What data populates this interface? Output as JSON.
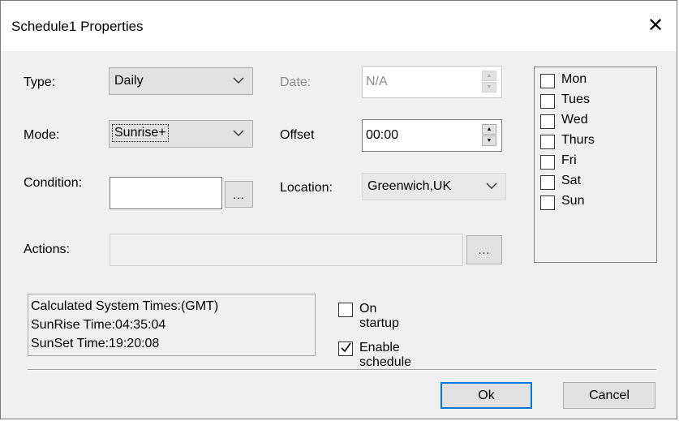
{
  "window": {
    "title": "Schedule1 Properties",
    "close_symbol": "✕"
  },
  "form": {
    "type_label": "Type:",
    "type_value": "Daily",
    "date_label": "Date:",
    "date_value": "N/A",
    "mode_label": "Mode:",
    "mode_value": "Sunrise+",
    "offset_label": "Offset",
    "offset_value": "00:00",
    "condition_label": "Condition:",
    "condition_value": "",
    "condition_browse": "...",
    "location_label": "Location:",
    "location_value": "Greenwich,UK",
    "actions_label": "Actions:",
    "actions_value": "",
    "actions_browse": "..."
  },
  "days": [
    {
      "label": "Mon",
      "checked": false
    },
    {
      "label": "Tues",
      "checked": false
    },
    {
      "label": "Wed",
      "checked": false
    },
    {
      "label": "Thurs",
      "checked": false
    },
    {
      "label": "Fri",
      "checked": false
    },
    {
      "label": "Sat",
      "checked": false
    },
    {
      "label": "Sun",
      "checked": false
    }
  ],
  "calculated": {
    "heading": "Calculated System Times:(GMT)",
    "sunrise": "SunRise Time:04:35:04",
    "sunset": "SunSet Time:19:20:08"
  },
  "options": {
    "on_startup_label": "On startup",
    "on_startup_checked": false,
    "enable_schedule_label": "Enable schedule",
    "enable_schedule_checked": true
  },
  "buttons": {
    "ok": "Ok",
    "cancel": "Cancel"
  },
  "colors": {
    "default_button_border": "#0078d7",
    "dialog_bg": "#f0f0f0"
  },
  "icons": {
    "dropdown": "chevron-down-icon",
    "spin_up": "spin-up-icon",
    "spin_down": "spin-down-icon",
    "checkmark": "checkmark-icon",
    "close": "close-icon"
  }
}
